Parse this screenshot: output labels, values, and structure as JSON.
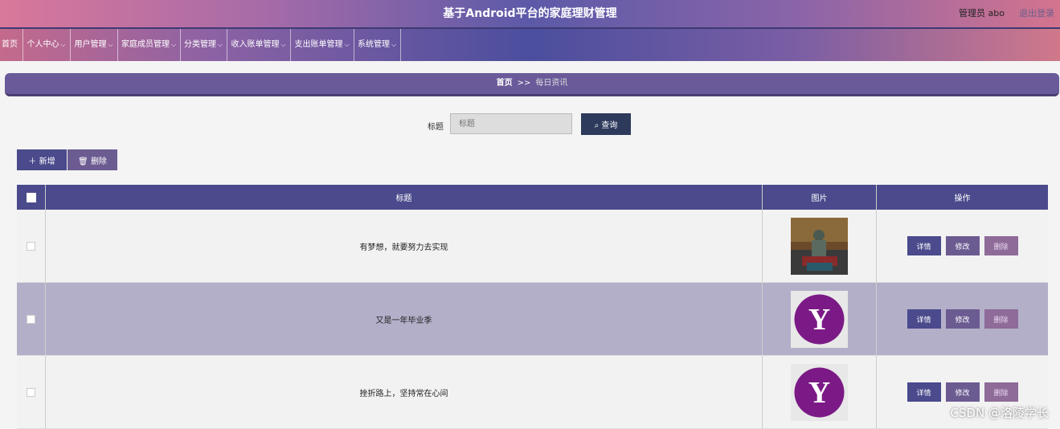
{
  "header": {
    "title": "基于Android平台的家庭理财管理",
    "admin": "管理员 abo",
    "logout": "退出登录"
  },
  "nav": [
    {
      "label": "首页",
      "chevron": false
    },
    {
      "label": "个人中心",
      "chevron": true
    },
    {
      "label": "用户管理",
      "chevron": true
    },
    {
      "label": "家庭成员管理",
      "chevron": true
    },
    {
      "label": "分类管理",
      "chevron": true
    },
    {
      "label": "收入账单管理",
      "chevron": true
    },
    {
      "label": "支出账单管理",
      "chevron": true
    },
    {
      "label": "系统管理",
      "chevron": true
    }
  ],
  "breadcrumb": {
    "home": "首页",
    "sep": ">>",
    "current": "每日资讯"
  },
  "search": {
    "label": "标题",
    "placeholder": "标题",
    "button": "查询"
  },
  "toolbar": {
    "add": "新增",
    "delete": "删除"
  },
  "table": {
    "headers": {
      "title": "标题",
      "image": "图片",
      "actions": "操作"
    },
    "rows": [
      {
        "title": "有梦想，就要努力去实现",
        "image": "photo"
      },
      {
        "title": "又是一年毕业季",
        "image": "yahoo-logo"
      },
      {
        "title": "挫折路上，坚持常在心间",
        "image": "yahoo-logo"
      }
    ],
    "actions": {
      "detail": "详情",
      "edit": "修改",
      "remove": "删除"
    }
  },
  "watermark": "CSDN @洛陵学长",
  "colors": {
    "primary": "#4a4a8c",
    "secondary": "#6b5b91",
    "highlight_row": "#b3afc9"
  }
}
